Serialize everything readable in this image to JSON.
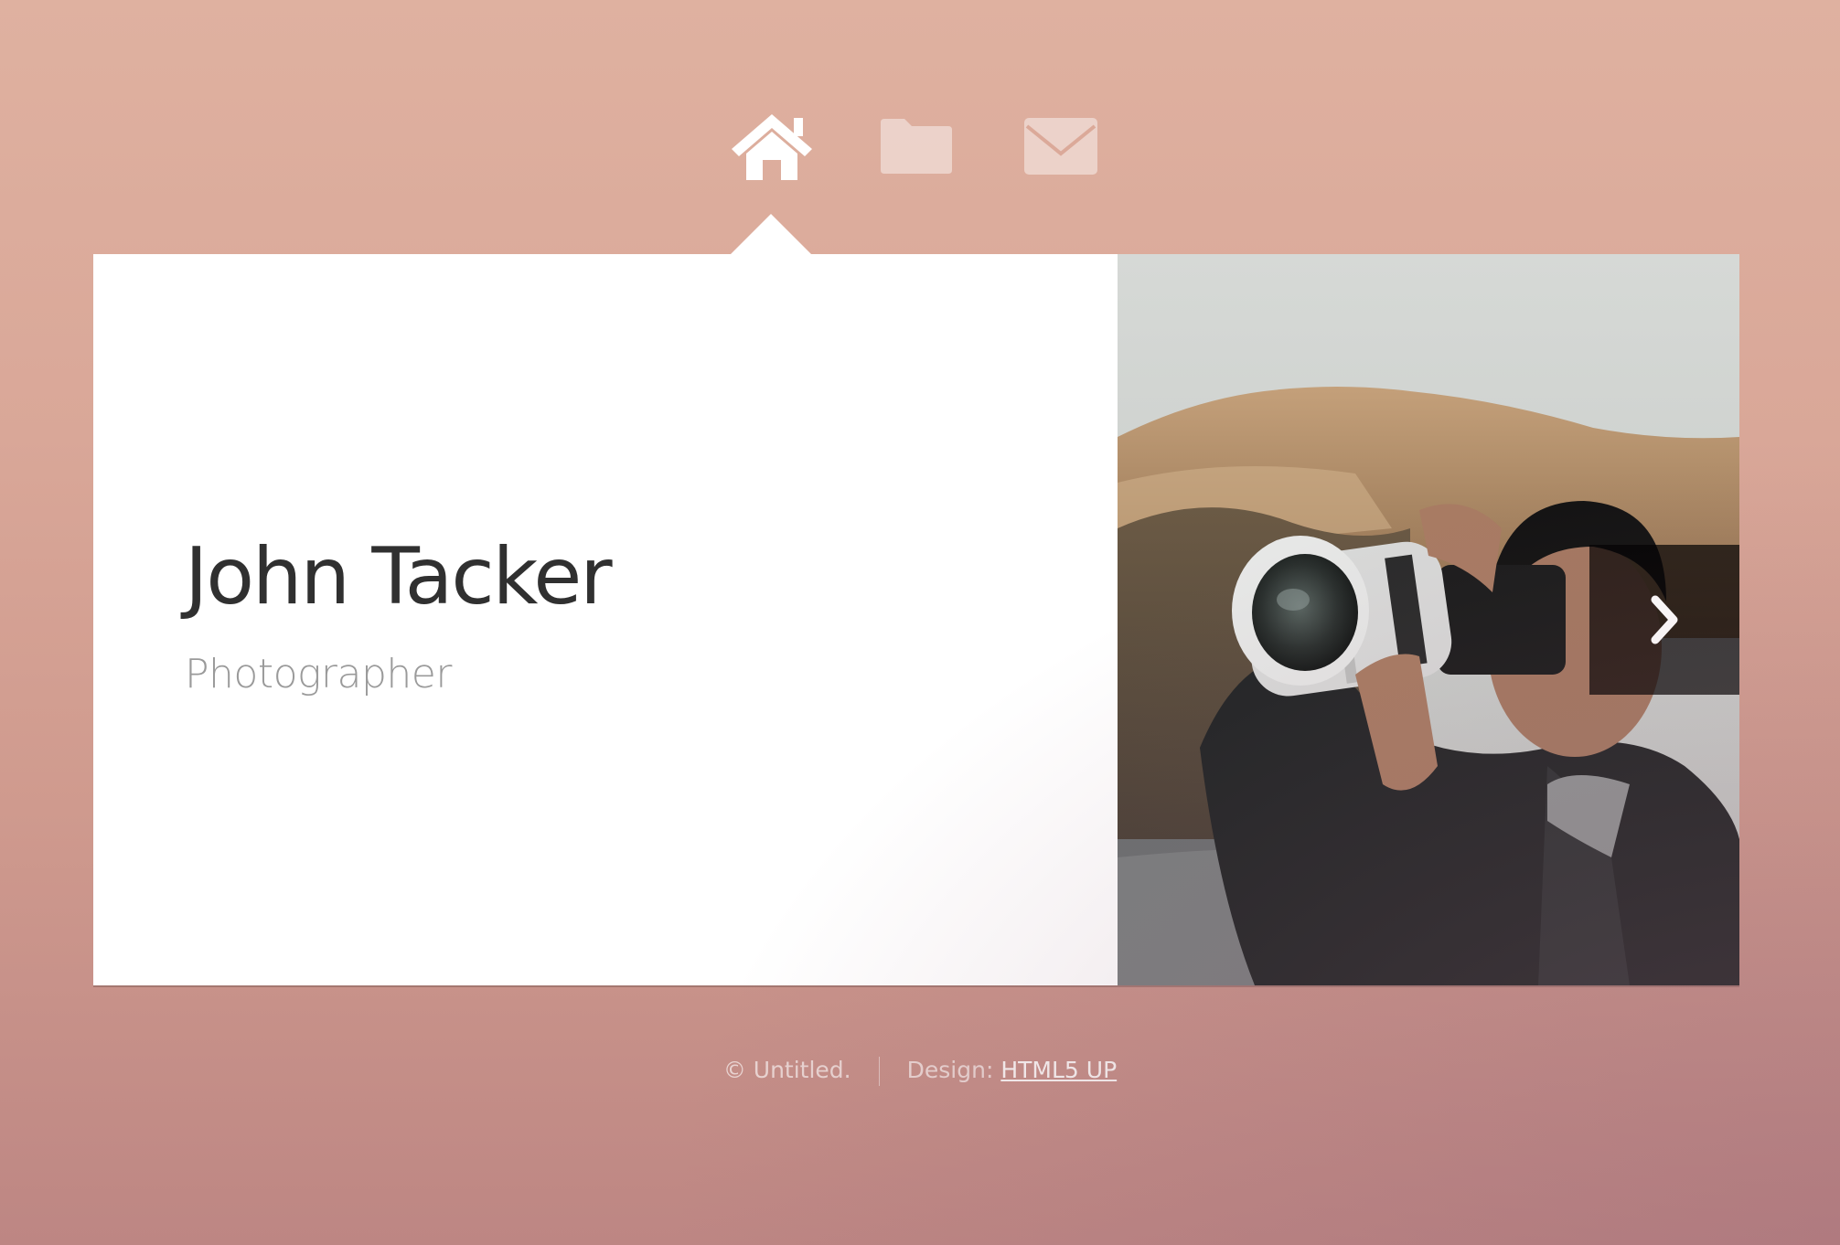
{
  "nav": {
    "items": [
      {
        "icon": "home-icon",
        "active": true
      },
      {
        "icon": "folder-icon",
        "active": false
      },
      {
        "icon": "envelope-icon",
        "active": false
      }
    ]
  },
  "profile": {
    "name": "John Tacker",
    "role": "Photographer"
  },
  "photo": {
    "alt": "Man holding a camera with a large telephoto lens"
  },
  "footer": {
    "copyright": "© Untitled.",
    "design_label": "Design:",
    "design_link": "HTML5 UP"
  },
  "colors": {
    "background_top": "#dfb1a0",
    "background_bottom": "#bd8683",
    "panel": "#ffffff",
    "name_text": "#303030",
    "role_text": "#9a9a9a"
  }
}
